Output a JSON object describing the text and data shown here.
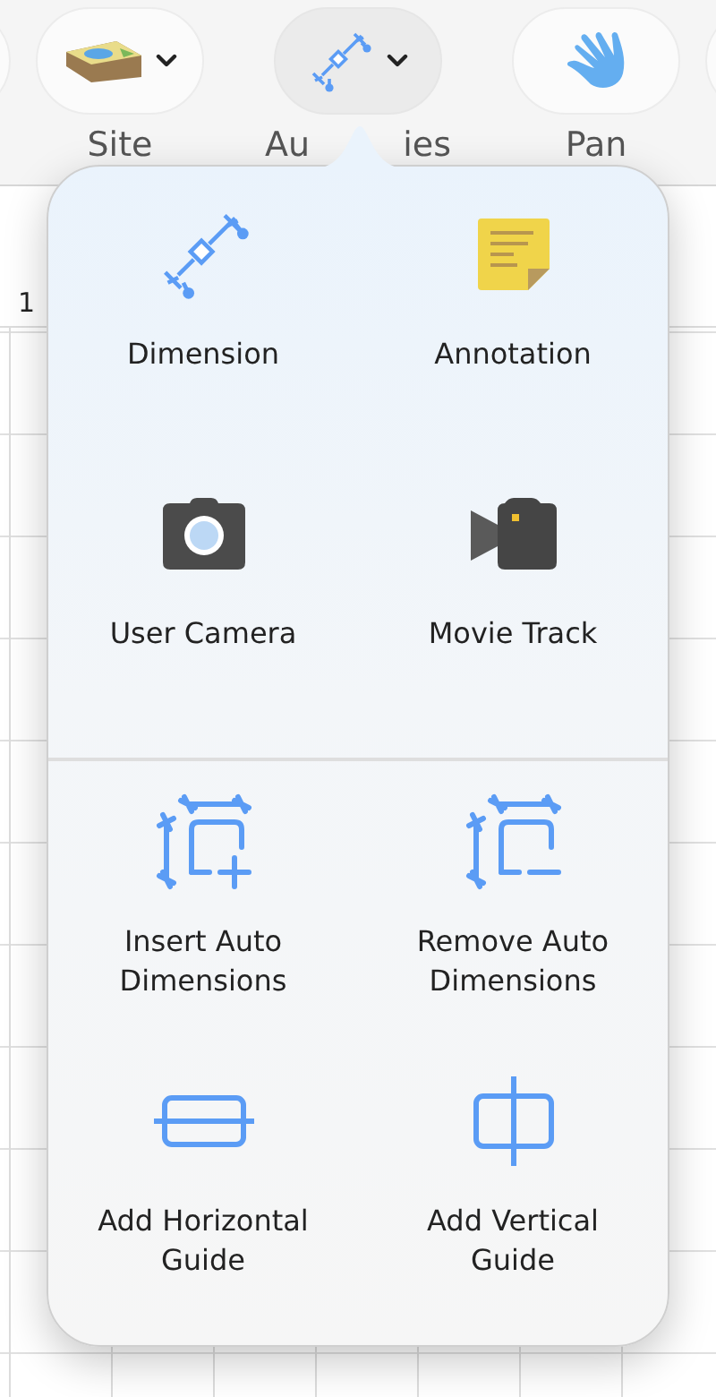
{
  "toolbar": [
    {
      "label": "Site",
      "selected": false,
      "has_menu": true
    },
    {
      "label_parts": [
        "Au",
        "ies"
      ],
      "selected": true,
      "has_menu": true
    },
    {
      "label": "Pan",
      "selected": false,
      "has_menu": false
    }
  ],
  "ruler": {
    "label": "1"
  },
  "popover": {
    "sections": [
      {
        "items": [
          {
            "label": "Dimension"
          },
          {
            "label": "Annotation"
          },
          {
            "label": "User Camera"
          },
          {
            "label": "Movie Track"
          }
        ]
      },
      {
        "items": [
          {
            "label": "Insert Auto Dimensions"
          },
          {
            "label": "Remove Auto Dimensions"
          },
          {
            "label": "Add Horizontal Guide"
          },
          {
            "label": "Add Vertical Guide"
          }
        ]
      }
    ]
  }
}
